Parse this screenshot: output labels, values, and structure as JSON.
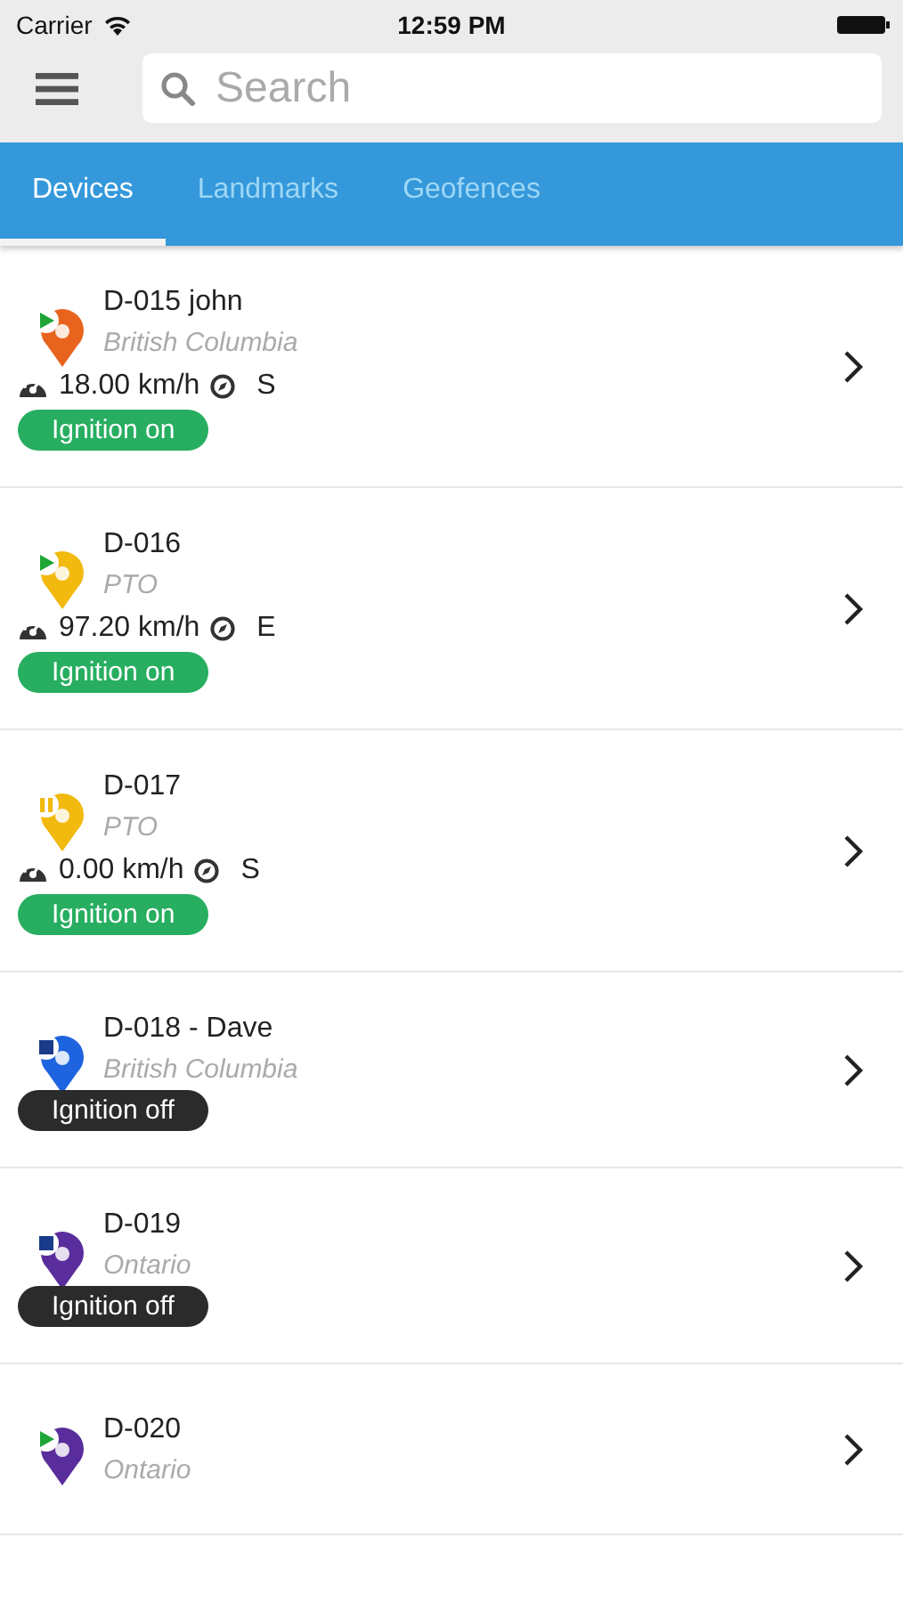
{
  "status_bar": {
    "carrier": "Carrier",
    "time": "12:59 PM"
  },
  "search": {
    "placeholder": "Search"
  },
  "tabs": [
    {
      "label": "Devices",
      "selected": true
    },
    {
      "label": "Landmarks",
      "selected": false
    },
    {
      "label": "Geofences",
      "selected": false
    }
  ],
  "devices": [
    {
      "name": "D-015 john",
      "region": "British Columbia",
      "color": "#e8641e",
      "kind": "moving",
      "speed": "18.00 km/h",
      "heading": "S",
      "ignition": "Ignition on",
      "ignition_on": true
    },
    {
      "name": "D-016",
      "region": "PTO",
      "color": "#f2b90f",
      "kind": "moving",
      "speed": "97.20 km/h",
      "heading": "E",
      "ignition": "Ignition on",
      "ignition_on": true
    },
    {
      "name": "D-017",
      "region": "PTO",
      "color": "#f2b90f",
      "kind": "paused",
      "speed": "0.00 km/h",
      "heading": "S",
      "ignition": "Ignition on",
      "ignition_on": true
    },
    {
      "name": "D-018 - Dave",
      "region": "British Columbia",
      "color": "#1e64e0",
      "kind": "stopped",
      "ignition": "Ignition off",
      "ignition_on": false
    },
    {
      "name": "D-019",
      "region": "Ontario",
      "color": "#5a2d9c",
      "kind": "stopped",
      "ignition": "Ignition off",
      "ignition_on": false
    },
    {
      "name": "D-020",
      "region": "Ontario",
      "color": "#5a2d9c",
      "kind": "moving"
    }
  ]
}
